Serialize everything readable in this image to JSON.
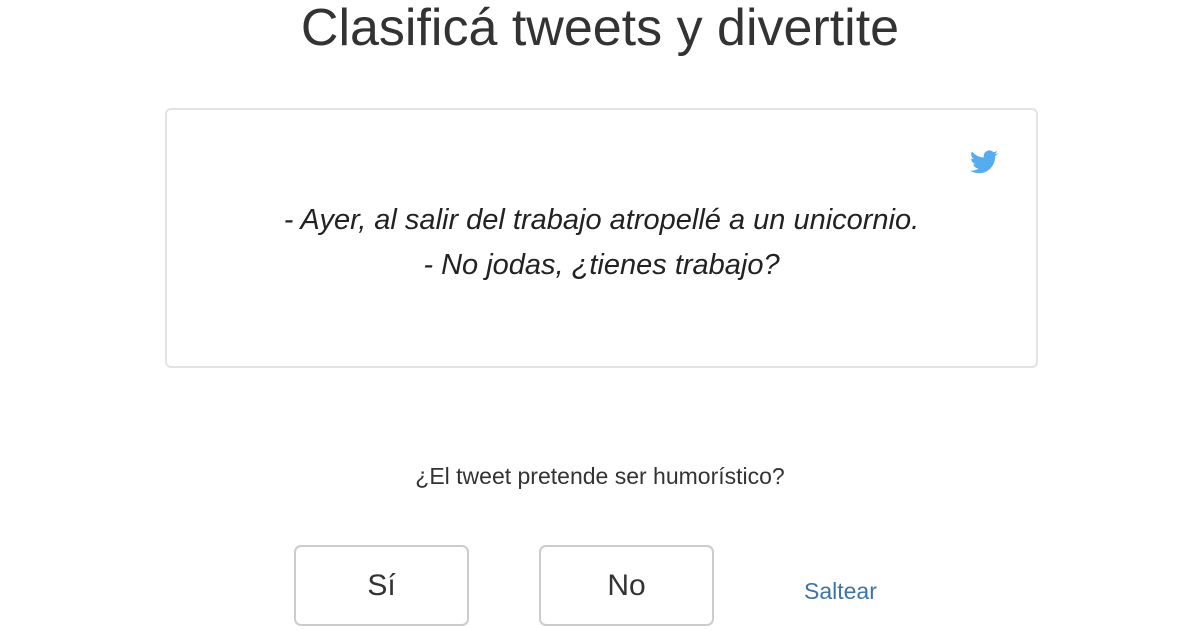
{
  "header": {
    "title": "Clasificá tweets y divertite"
  },
  "tweet": {
    "text": "- Ayer, al salir del trabajo atropellé a un unicornio.\n- No jodas, ¿tienes trabajo?",
    "icon": "twitter-bird-icon",
    "icon_color": "#55acee"
  },
  "classification": {
    "question": "¿El tweet pretende ser humorístico?",
    "yes_label": "Sí",
    "no_label": "No",
    "skip_label": "Saltear",
    "link_color": "#3d74a8"
  }
}
